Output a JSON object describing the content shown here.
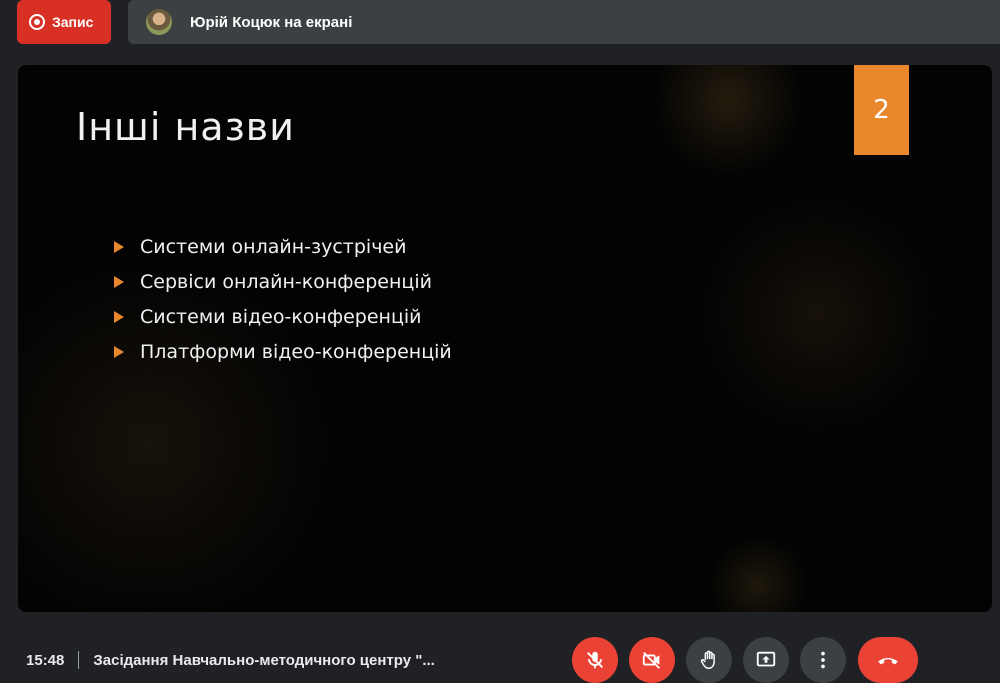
{
  "top_bar": {
    "record_label": "Запис",
    "presenter_text": "Юрій Коцюк на екрані"
  },
  "slide": {
    "title": "Інші назви",
    "number": "2",
    "bullets": [
      "Системи онлайн-зустрічей",
      "Сервіси онлайн-конференцій",
      "Системи відео-конференцій",
      "Платформи відео-конференцій"
    ],
    "accent_color": "#e8872c"
  },
  "bottom_bar": {
    "time": "15:48",
    "meeting_title": "Засідання Навчально-методичного центру \"...",
    "controls": [
      "mic-off-icon",
      "camera-off-icon",
      "raise-hand-icon",
      "present-screen-icon",
      "more-options-icon",
      "hang-up-icon"
    ]
  }
}
